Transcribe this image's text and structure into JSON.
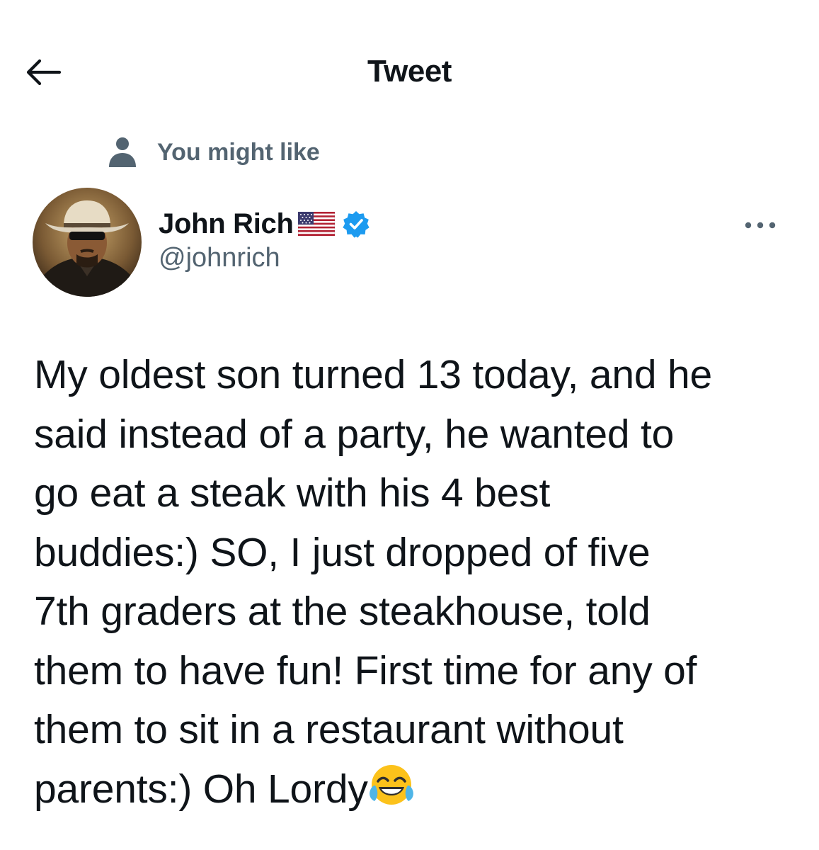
{
  "header": {
    "title": "Tweet",
    "back_icon": "arrow-left-icon"
  },
  "social_context": {
    "icon": "person-icon",
    "label": "You might like"
  },
  "author": {
    "display_name": "John Rich",
    "name_emoji": "us-flag-icon",
    "verified": true,
    "verified_color": "#1d9bf0",
    "handle": "@johnrich",
    "avatar": "cowboy-hat-avatar"
  },
  "more_icon": "more-horizontal-icon",
  "tweet": {
    "lines": [
      "My oldest son turned 13 today, and he",
      "said instead of a party, he wanted to",
      "go eat a steak with his 4 best",
      "buddies:) SO, I just dropped of five",
      "7th graders at the steakhouse, told",
      "them to have fun! First time for any of",
      "them to sit in a restaurant without",
      "parents:) Oh Lordy"
    ],
    "trailing_emoji": "face-with-tears-of-joy-icon"
  },
  "colors": {
    "text_primary": "#0f1419",
    "text_secondary": "#536471",
    "accent": "#1d9bf0",
    "background": "#ffffff"
  }
}
